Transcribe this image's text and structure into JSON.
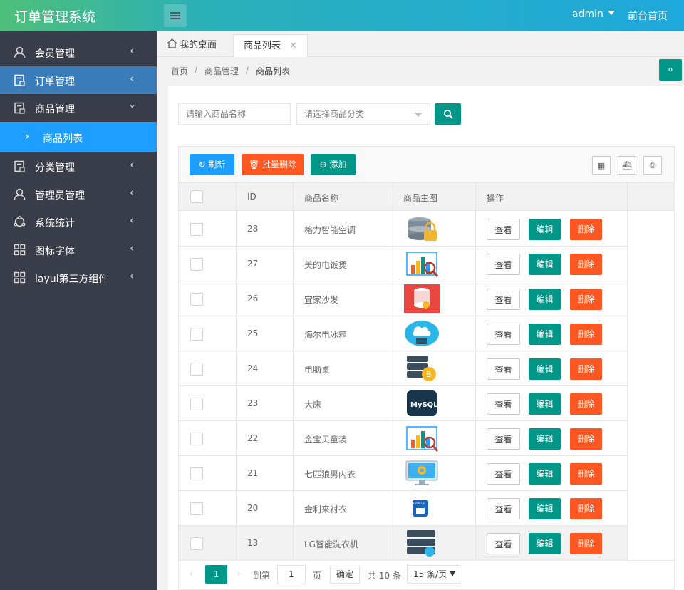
{
  "app": {
    "title": "订单管理系统",
    "user": "admin",
    "front_link": "前台首页"
  },
  "sidebar": {
    "items": [
      {
        "label": "会员管理",
        "icon": "user-icon"
      },
      {
        "label": "订单管理",
        "icon": "order-icon"
      },
      {
        "label": "商品管理",
        "icon": "goods-icon"
      },
      {
        "label": "商品列表",
        "icon": "chevron-right-icon"
      },
      {
        "label": "分类管理",
        "icon": "category-icon"
      },
      {
        "label": "管理员管理",
        "icon": "admin-icon"
      },
      {
        "label": "系统统计",
        "icon": "stats-icon"
      },
      {
        "label": "图标字体",
        "icon": "grid-icon"
      },
      {
        "label": "layui第三方组件",
        "icon": "grid-icon"
      }
    ]
  },
  "tabs": [
    {
      "label": "我的桌面"
    },
    {
      "label": "商品列表"
    }
  ],
  "breadcrumb": [
    "首页",
    "商品管理",
    "商品列表"
  ],
  "refresh_icon_text": "ℴ",
  "search": {
    "name_placeholder": "请输入商品名称",
    "category_placeholder": "请选择商品分类"
  },
  "toolbar": {
    "refresh": "刷新",
    "batch_delete": "批量删除",
    "add": "添加"
  },
  "table": {
    "headers": [
      "ID",
      "商品名称",
      "商品主图",
      "操作"
    ],
    "rows": [
      {
        "id": "28",
        "name": "格力智能空调",
        "thumb": "database-lock"
      },
      {
        "id": "27",
        "name": "美的电饭煲",
        "thumb": "chart-analysis"
      },
      {
        "id": "26",
        "name": "宜家沙发",
        "thumb": "database-red"
      },
      {
        "id": "25",
        "name": "海尔电冰箱",
        "thumb": "cloud-server"
      },
      {
        "id": "24",
        "name": "电脑桌",
        "thumb": "server-bitcoin"
      },
      {
        "id": "23",
        "name": "大床",
        "thumb": "mysql"
      },
      {
        "id": "22",
        "name": "金宝贝童装",
        "thumb": "chart-analysis"
      },
      {
        "id": "21",
        "name": "七匹狼男内衣",
        "thumb": "monitor-gear"
      },
      {
        "id": "20",
        "name": "金利来衬衣",
        "thumb": "oracle"
      },
      {
        "id": "13",
        "name": "LG智能洗衣机",
        "thumb": "server-cloud"
      }
    ],
    "actions": {
      "view": "查看",
      "edit": "编辑",
      "delete": "删除"
    }
  },
  "pager": {
    "current": "1",
    "goto": "到第",
    "page_value": "1",
    "page_unit": "页",
    "confirm": "确定",
    "total": "共 10 条",
    "per_page": "15 条/页"
  },
  "colors": {
    "primary": "#009688",
    "danger": "#ff5722",
    "info": "#1e9fff",
    "sidebar": "#393d49"
  }
}
